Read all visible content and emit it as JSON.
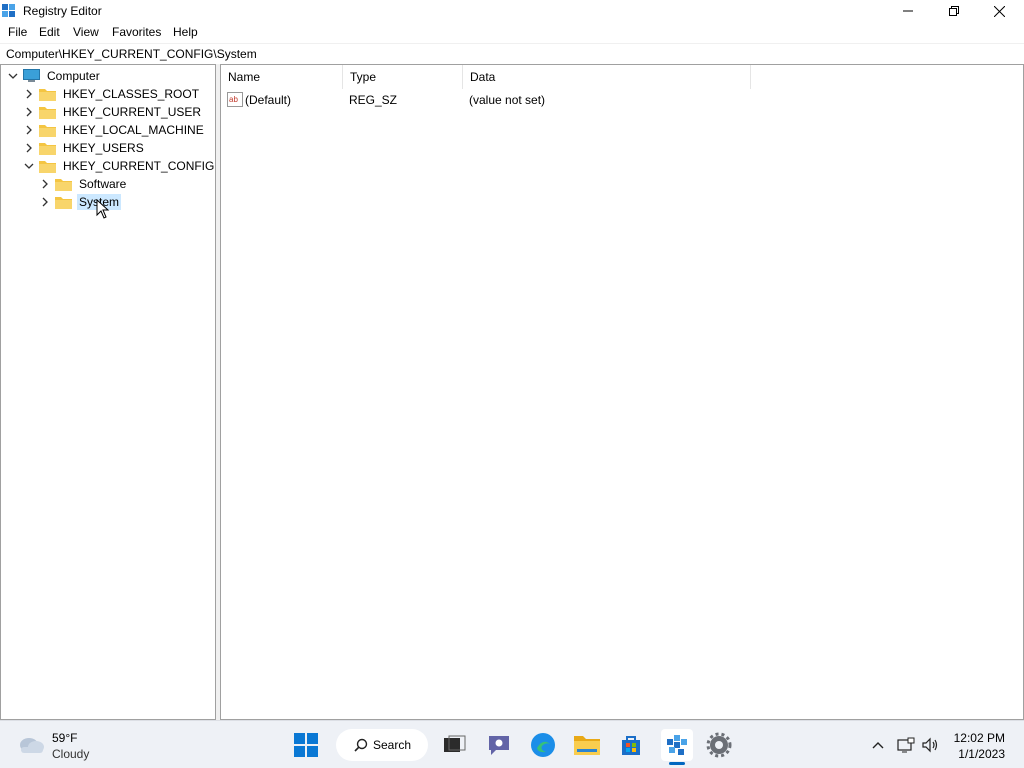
{
  "window": {
    "title": "Registry Editor",
    "minimize_icon": "minimize-icon",
    "restore_icon": "restore-icon",
    "close_icon": "close-icon"
  },
  "menu": {
    "file": "File",
    "edit": "Edit",
    "view": "View",
    "favorites": "Favorites",
    "help": "Help"
  },
  "address": "Computer\\HKEY_CURRENT_CONFIG\\System",
  "tree": {
    "root": "Computer",
    "hives": [
      {
        "label": "HKEY_CLASSES_ROOT",
        "expanded": false
      },
      {
        "label": "HKEY_CURRENT_USER",
        "expanded": false
      },
      {
        "label": "HKEY_LOCAL_MACHINE",
        "expanded": false
      },
      {
        "label": "HKEY_USERS",
        "expanded": false
      },
      {
        "label": "HKEY_CURRENT_CONFIG",
        "expanded": true
      }
    ],
    "children": [
      {
        "label": "Software",
        "selected": false
      },
      {
        "label": "System",
        "selected": true
      }
    ]
  },
  "list": {
    "columns": {
      "name": "Name",
      "type": "Type",
      "data": "Data"
    },
    "rows": [
      {
        "name": "(Default)",
        "type": "REG_SZ",
        "data": "(value not set)",
        "icon": "string-value-icon"
      }
    ]
  },
  "taskbar": {
    "weather": {
      "temp": "59°F",
      "condition": "Cloudy",
      "icon": "cloudy-icon"
    },
    "search_label": "Search",
    "apps": [
      "start-icon",
      "search-icon",
      "task-view-icon",
      "chat-icon",
      "edge-icon",
      "file-explorer-icon",
      "store-icon",
      "registry-editor-icon",
      "settings-icon"
    ],
    "tray": {
      "time": "12:02 PM",
      "date": "1/1/2023"
    }
  },
  "colors": {
    "selection": "#cce8ff",
    "folder": "#f4c542",
    "accent": "#0067c0"
  }
}
